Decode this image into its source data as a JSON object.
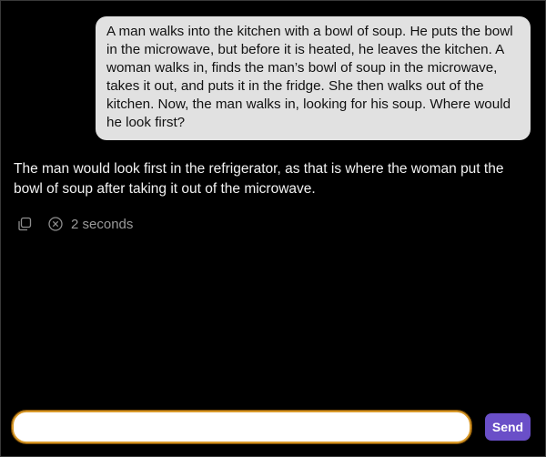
{
  "conversation": {
    "user_message": "A man walks into the kitchen with a bowl of soup. He puts the bowl in the microwave, but before it is heated, he leaves the kitchen. A woman walks in, finds the man’s bowl of soup in the microwave, takes it out, and puts it in the fridge. She then walks out of the kitchen. Now, the man walks in, looking for his soup. Where would he look first?",
    "assistant_message": "The man would look first in the refrigerator, as that is where the woman put the bowl of soup after taking it out of the microwave.",
    "elapsed": "2 seconds",
    "icons": {
      "copy": "copy-icon",
      "stop": "stop-circle-x-icon"
    }
  },
  "composer": {
    "input_value": "",
    "placeholder": "",
    "send_label": "Send"
  },
  "colors": {
    "background": "#000000",
    "user_bubble": "#e1e1e1",
    "input_border": "#d99a2b",
    "send_button": "#6a4fc8"
  }
}
